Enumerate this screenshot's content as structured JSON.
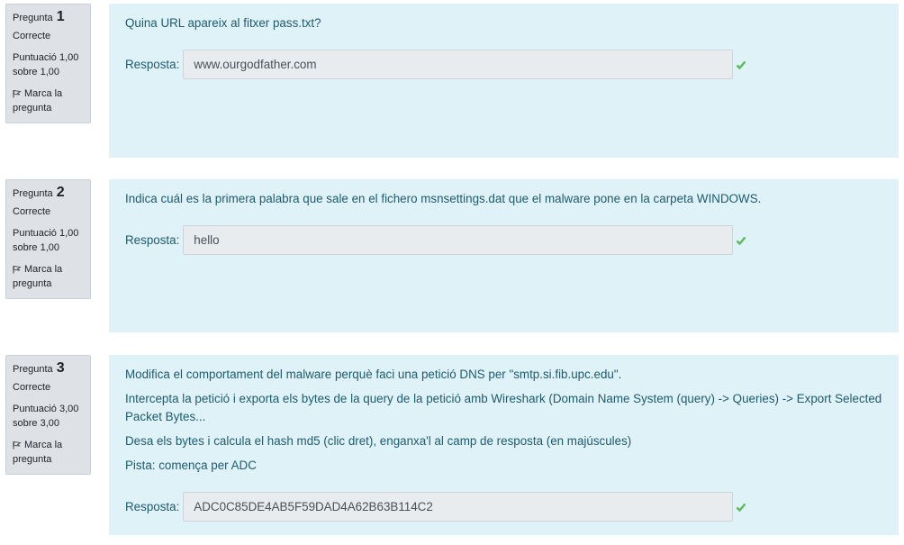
{
  "questions": [
    {
      "label": "Pregunta",
      "number": "1",
      "state": "Correcte",
      "grade": "Puntuació 1,00 sobre 1,00",
      "flag": "Marca la pregunta",
      "text": [
        "Quina URL apareix al fitxer pass.txt?"
      ],
      "answer_label": "Resposta:",
      "answer_value": "www.ourgodfather.com",
      "result": "correct-icon"
    },
    {
      "label": "Pregunta",
      "number": "2",
      "state": "Correcte",
      "grade": "Puntuació 1,00 sobre 1,00",
      "flag": "Marca la pregunta",
      "text": [
        "Indica cuál es la primera palabra que sale en el fichero msnsettings.dat que el malware pone en la carpeta WINDOWS."
      ],
      "answer_label": "Resposta:",
      "answer_value": "hello",
      "result": "correct-icon"
    },
    {
      "label": "Pregunta",
      "number": "3",
      "state": "Correcte",
      "grade": "Puntuació 3,00 sobre 3,00",
      "flag": "Marca la pregunta",
      "text": [
        "Modifica el comportament del malware perquè faci una petició DNS per \"smtp.si.fib.upc.edu\".",
        "Intercepta la petició i exporta els bytes de la query de la petició amb Wireshark (Domain Name System (query) -> Queries) -> Export Selected Packet Bytes...",
        "Desa els bytes i calcula el hash md5 (clic dret), enganxa'l al camp de resposta (en majúscules)",
        "Pista: comença per ADC"
      ],
      "answer_label": "Resposta:",
      "answer_value": "ADC0C85DE4AB5F59DAD4A62B63B114C2",
      "result": "correct-icon"
    }
  ],
  "colors": {
    "content_bg": "#def2f8",
    "content_text": "#1f5b6c",
    "info_bg": "#dee2e6",
    "check": "#5cb85c"
  }
}
